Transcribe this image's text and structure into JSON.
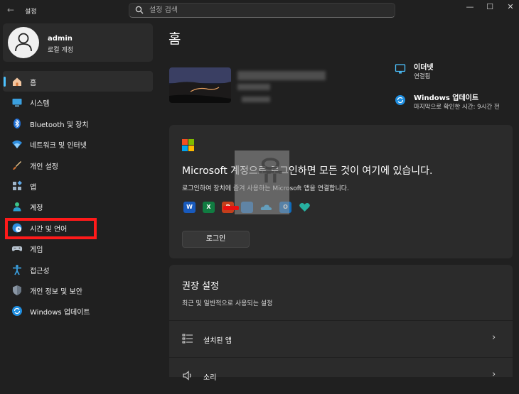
{
  "window": {
    "title": "설정",
    "back_glyph": "←",
    "controls": [
      "—",
      "☐",
      "✕"
    ]
  },
  "search": {
    "placeholder": "설정 검색"
  },
  "user": {
    "name": "admin",
    "account_type": "로컬 계정"
  },
  "sidebar": {
    "selected": "홈",
    "highlighted": "시간 및 언어",
    "items": [
      {
        "label": "홈",
        "icon": "home-icon"
      },
      {
        "label": "시스템",
        "icon": "monitor-icon"
      },
      {
        "label": "Bluetooth 및 장치",
        "icon": "bluetooth-icon"
      },
      {
        "label": "네트워크 및 인터넷",
        "icon": "wifi-icon"
      },
      {
        "label": "개인 설정",
        "icon": "brush-icon"
      },
      {
        "label": "앱",
        "icon": "apps-icon"
      },
      {
        "label": "계정",
        "icon": "person-icon"
      },
      {
        "label": "시간 및 언어",
        "icon": "globe-clock-icon"
      },
      {
        "label": "게임",
        "icon": "gamepad-icon"
      },
      {
        "label": "접근성",
        "icon": "accessibility-icon"
      },
      {
        "label": "개인 정보 및 보안",
        "icon": "shield-icon"
      },
      {
        "label": "Windows 업데이트",
        "icon": "update-icon"
      }
    ]
  },
  "main": {
    "title": "홈",
    "status": [
      {
        "title": "이더넷",
        "subtitle": "연결됨",
        "icon": "ethernet-icon"
      },
      {
        "title": "Windows 업데이트",
        "subtitle": "마지막으로 확인한 시간: 9시간 전",
        "icon": "update-icon"
      }
    ],
    "ms_card": {
      "heading": "Microsoft 계정으로 로그인하면 모든 것이 여기에 있습니다.",
      "description": "로그인하여 장치에 즐겨 사용하는 Microsoft 앱을 연결합니다.",
      "apps": [
        "word",
        "excel",
        "powerpoint",
        "defender",
        "onedrive",
        "outlook",
        "family"
      ],
      "button": "로그인"
    },
    "recommended": {
      "title": "권장 설정",
      "subtitle": "최근 및 일반적으로 사용되는 설정",
      "items": [
        {
          "label": "설치된 앱",
          "icon": "list-icon"
        },
        {
          "label": "소리",
          "icon": "speaker-icon"
        }
      ]
    }
  },
  "colors": {
    "background": "#202020",
    "card": "#2b2b2b",
    "accent": "#4cc2ff",
    "highlight_box": "#ff1a1a"
  }
}
